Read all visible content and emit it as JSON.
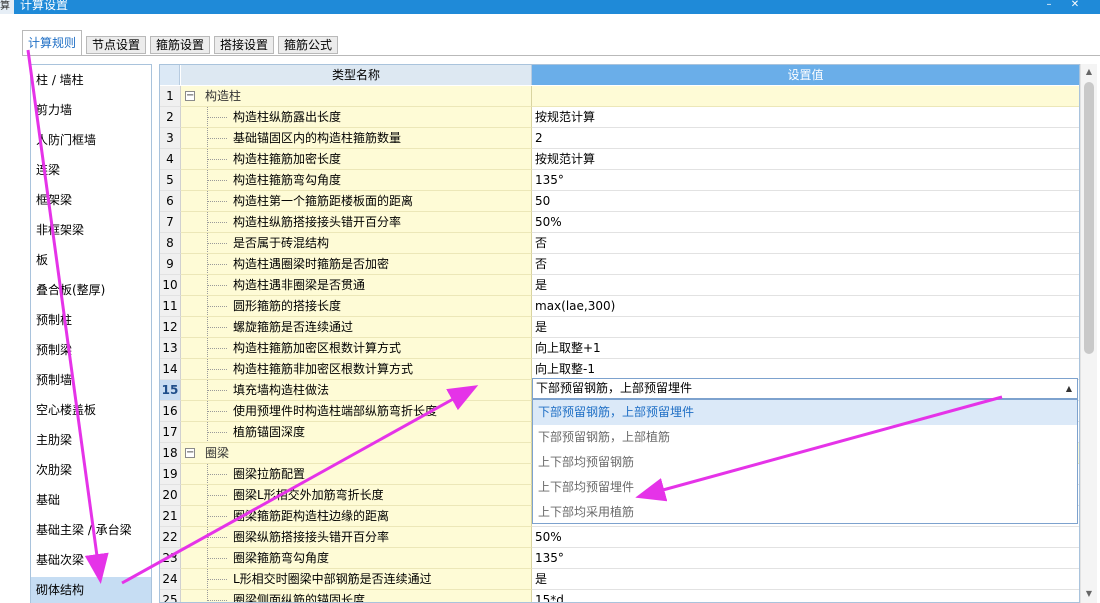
{
  "window": {
    "app_fragment": "算",
    "title": "计算设置",
    "minimize_glyph": "–",
    "close_glyph": "✕"
  },
  "tabs": [
    {
      "label": "计算规则",
      "active": true
    },
    {
      "label": "节点设置",
      "active": false
    },
    {
      "label": "箍筋设置",
      "active": false
    },
    {
      "label": "搭接设置",
      "active": false
    },
    {
      "label": "箍筋公式",
      "active": false
    }
  ],
  "sidebar": {
    "items": [
      {
        "label": "柱 / 墙柱"
      },
      {
        "label": "剪力墙"
      },
      {
        "label": "人防门框墙"
      },
      {
        "label": "连梁"
      },
      {
        "label": "框架梁"
      },
      {
        "label": "非框架梁"
      },
      {
        "label": "板"
      },
      {
        "label": "叠合板(整厚)"
      },
      {
        "label": "预制柱"
      },
      {
        "label": "预制梁"
      },
      {
        "label": "预制墙"
      },
      {
        "label": "空心楼盖板"
      },
      {
        "label": "主肋梁"
      },
      {
        "label": "次肋梁"
      },
      {
        "label": "基础"
      },
      {
        "label": "基础主梁 / 承台梁"
      },
      {
        "label": "基础次梁"
      },
      {
        "label": "砌体结构",
        "selected": true
      }
    ]
  },
  "table": {
    "header": {
      "col_name": "类型名称",
      "col_value": "设置值"
    },
    "expander_glyph": "−",
    "current_row": "15",
    "rows": [
      {
        "num": "1",
        "name": "构造柱",
        "value": "",
        "group": true
      },
      {
        "num": "2",
        "name": "构造柱纵筋露出长度",
        "value": "按规范计算"
      },
      {
        "num": "3",
        "name": "基础锚固区内的构造柱箍筋数量",
        "value": "2"
      },
      {
        "num": "4",
        "name": "构造柱箍筋加密长度",
        "value": "按规范计算"
      },
      {
        "num": "5",
        "name": "构造柱箍筋弯勾角度",
        "value": "135°"
      },
      {
        "num": "6",
        "name": "构造柱第一个箍筋距楼板面的距离",
        "value": "50"
      },
      {
        "num": "7",
        "name": "构造柱纵筋搭接接头错开百分率",
        "value": "50%"
      },
      {
        "num": "8",
        "name": "是否属于砖混结构",
        "value": "否"
      },
      {
        "num": "9",
        "name": "构造柱遇圈梁时箍筋是否加密",
        "value": "否"
      },
      {
        "num": "10",
        "name": "构造柱遇非圈梁是否贯通",
        "value": "是"
      },
      {
        "num": "11",
        "name": "圆形箍筋的搭接长度",
        "value": "max(lae,300)"
      },
      {
        "num": "12",
        "name": "螺旋箍筋是否连续通过",
        "value": "是"
      },
      {
        "num": "13",
        "name": "构造柱箍筋加密区根数计算方式",
        "value": "向上取整+1"
      },
      {
        "num": "14",
        "name": "构造柱箍筋非加密区根数计算方式",
        "value": "向上取整-1"
      },
      {
        "num": "15",
        "name": "填充墙构造柱做法",
        "value": ""
      },
      {
        "num": "16",
        "name": "使用预埋件时构造柱端部纵筋弯折长度",
        "value": ""
      },
      {
        "num": "17",
        "name": "植筋锚固深度",
        "value": ""
      },
      {
        "num": "18",
        "name": "圈梁",
        "value": "",
        "group": true
      },
      {
        "num": "19",
        "name": "圈梁拉筋配置",
        "value": ""
      },
      {
        "num": "20",
        "name": "圈梁L形相交外加筋弯折长度",
        "value": ""
      },
      {
        "num": "21",
        "name": "圈梁箍筋距构造柱边缘的距离",
        "value": ""
      },
      {
        "num": "22",
        "name": "圈梁纵筋搭接接头错开百分率",
        "value": "50%"
      },
      {
        "num": "23",
        "name": "圈梁箍筋弯勾角度",
        "value": "135°"
      },
      {
        "num": "24",
        "name": "L形相交时圈梁中部钢筋是否连续通过",
        "value": "是"
      },
      {
        "num": "25",
        "name": "圈梁侧面纵筋的锚固长度",
        "value": "15*d"
      }
    ]
  },
  "combo": {
    "value": "下部预留钢筋，上部预留埋件",
    "caret": "▲",
    "options": [
      {
        "label": "下部预留钢筋，上部预留埋件",
        "selected": true
      },
      {
        "label": "下部预留钢筋，上部植筋"
      },
      {
        "label": "上下部均预留钢筋"
      },
      {
        "label": "上下部均预留埋件"
      },
      {
        "label": "上下部均采用植筋"
      }
    ]
  },
  "scrollbar": {
    "up_glyph": "▲",
    "down_glyph": "▼"
  },
  "colors": {
    "annotation": "#e533e8",
    "value_header": "#6aaee9",
    "name_cell": "#fefbd6",
    "accent": "#1f6fc5"
  }
}
